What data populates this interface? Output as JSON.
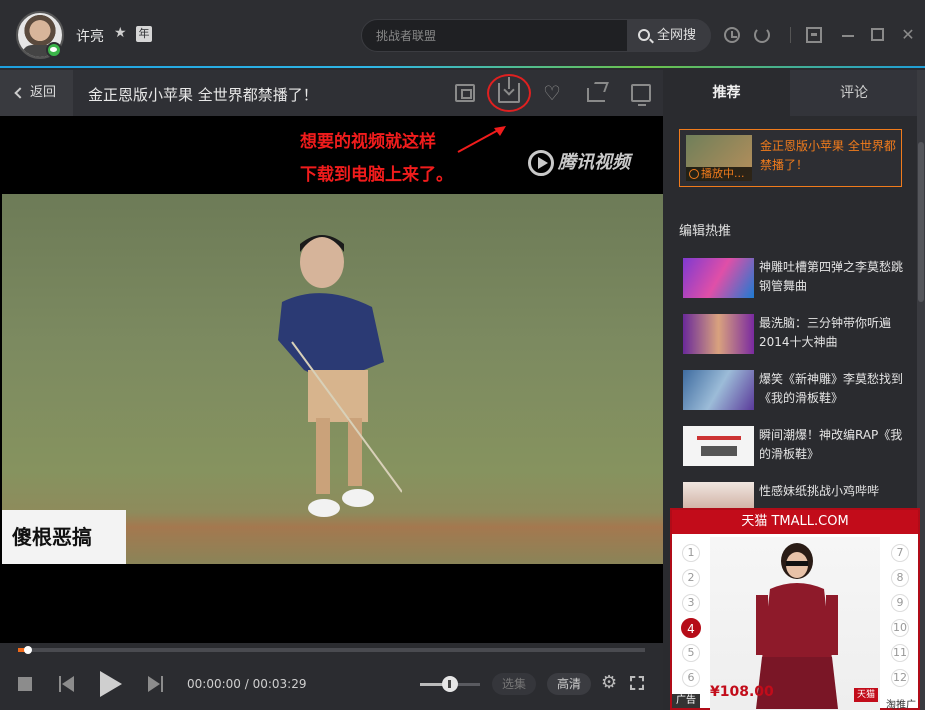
{
  "user": {
    "name": "许亮",
    "year_badge": "年"
  },
  "search": {
    "placeholder": "挑战者联盟",
    "button_label": "全网搜"
  },
  "title_bar": {
    "back_label": "返回",
    "video_title": "金正恩版小苹果 全世界都禁播了！"
  },
  "video": {
    "annotation_line1": "想要的视频就这样",
    "annotation_line2": "下载到电脑上来了。",
    "brand": "腾讯视频",
    "watermark": "傻根恶搞"
  },
  "controls": {
    "time_current": "00:00:00",
    "time_total": "00:03:29",
    "time_separator": " / ",
    "episode_label": "选集",
    "quality_label": "高清",
    "progress_fraction": 0.012,
    "volume_fraction": 0.45
  },
  "panel": {
    "tabs": [
      {
        "label": "推荐"
      },
      {
        "label": "评论"
      }
    ],
    "now_playing": {
      "badge": "播放中...",
      "title": "金正恩版小苹果 全世界都禁播了！"
    },
    "section_title": "编辑热推",
    "items": [
      {
        "title": "神雕吐槽第四弹之李莫愁跳钢管舞曲"
      },
      {
        "title": "最洗脑：三分钟带你听遍2014十大神曲"
      },
      {
        "title": "爆笑《新神雕》李莫愁找到《我的滑板鞋》"
      },
      {
        "title": "瞬间潮爆！神改编RAP《我的滑板鞋》"
      },
      {
        "title": "性感妹纸挑战小鸡哔哔"
      }
    ]
  },
  "ad": {
    "header": "天猫 TMALL.COM",
    "price": "¥108.00",
    "tmall_tag": "天猫",
    "label": "广告",
    "promo": "淘推广",
    "numbers_left": [
      "1",
      "2",
      "3",
      "4",
      "5",
      "6"
    ],
    "numbers_right": [
      "7",
      "8",
      "9",
      "10",
      "11",
      "12"
    ],
    "active_number": "4"
  },
  "colors": {
    "accent": "#1e9ed8",
    "orange": "#f07b1c",
    "annotation_red": "#f01c1c",
    "tmall_red": "#c20c1a"
  }
}
